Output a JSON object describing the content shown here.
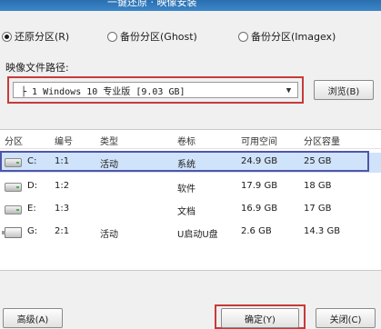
{
  "window": {
    "title": "一键还原 · 映像安装"
  },
  "mode_options": [
    {
      "label": "还原分区(R)",
      "checked": true
    },
    {
      "label": "备份分区(Ghost)",
      "checked": false
    },
    {
      "label": "备份分区(Imagex)",
      "checked": false
    }
  ],
  "image_path": {
    "label": "映像文件路径:",
    "selected": "├ 1 Windows 10 专业版 [9.03 GB]",
    "browse_label": "浏览(B)"
  },
  "partition_table": {
    "headers": [
      "分区",
      "编号",
      "类型",
      "卷标",
      "可用空间",
      "分区容量"
    ],
    "rows": [
      {
        "drive": "C:",
        "number": "1:1",
        "type": "活动",
        "label": "系统",
        "free": "24.9 GB",
        "size": "25 GB",
        "icon": "hard-drive-icon",
        "selected": true
      },
      {
        "drive": "D:",
        "number": "1:2",
        "type": "",
        "label": "软件",
        "free": "17.9 GB",
        "size": "18 GB",
        "icon": "hard-drive-icon",
        "selected": false
      },
      {
        "drive": "E:",
        "number": "1:3",
        "type": "",
        "label": "文档",
        "free": "16.9 GB",
        "size": "17 GB",
        "icon": "hard-drive-icon",
        "selected": false
      },
      {
        "drive": "G:",
        "number": "2:1",
        "type": "活动",
        "label": "U启动U盘",
        "free": "2.6 GB",
        "size": "14.3 GB",
        "icon": "usb-drive-icon",
        "selected": false
      }
    ]
  },
  "buttons": {
    "advanced": "高级(A)",
    "ok": "确定(Y)",
    "close": "关闭(C)"
  },
  "colors": {
    "title_bar": "#2a6fb0",
    "selection_bg": "#cfe3fa",
    "highlight_red": "#c73a3a",
    "highlight_blue": "#5254a8"
  }
}
